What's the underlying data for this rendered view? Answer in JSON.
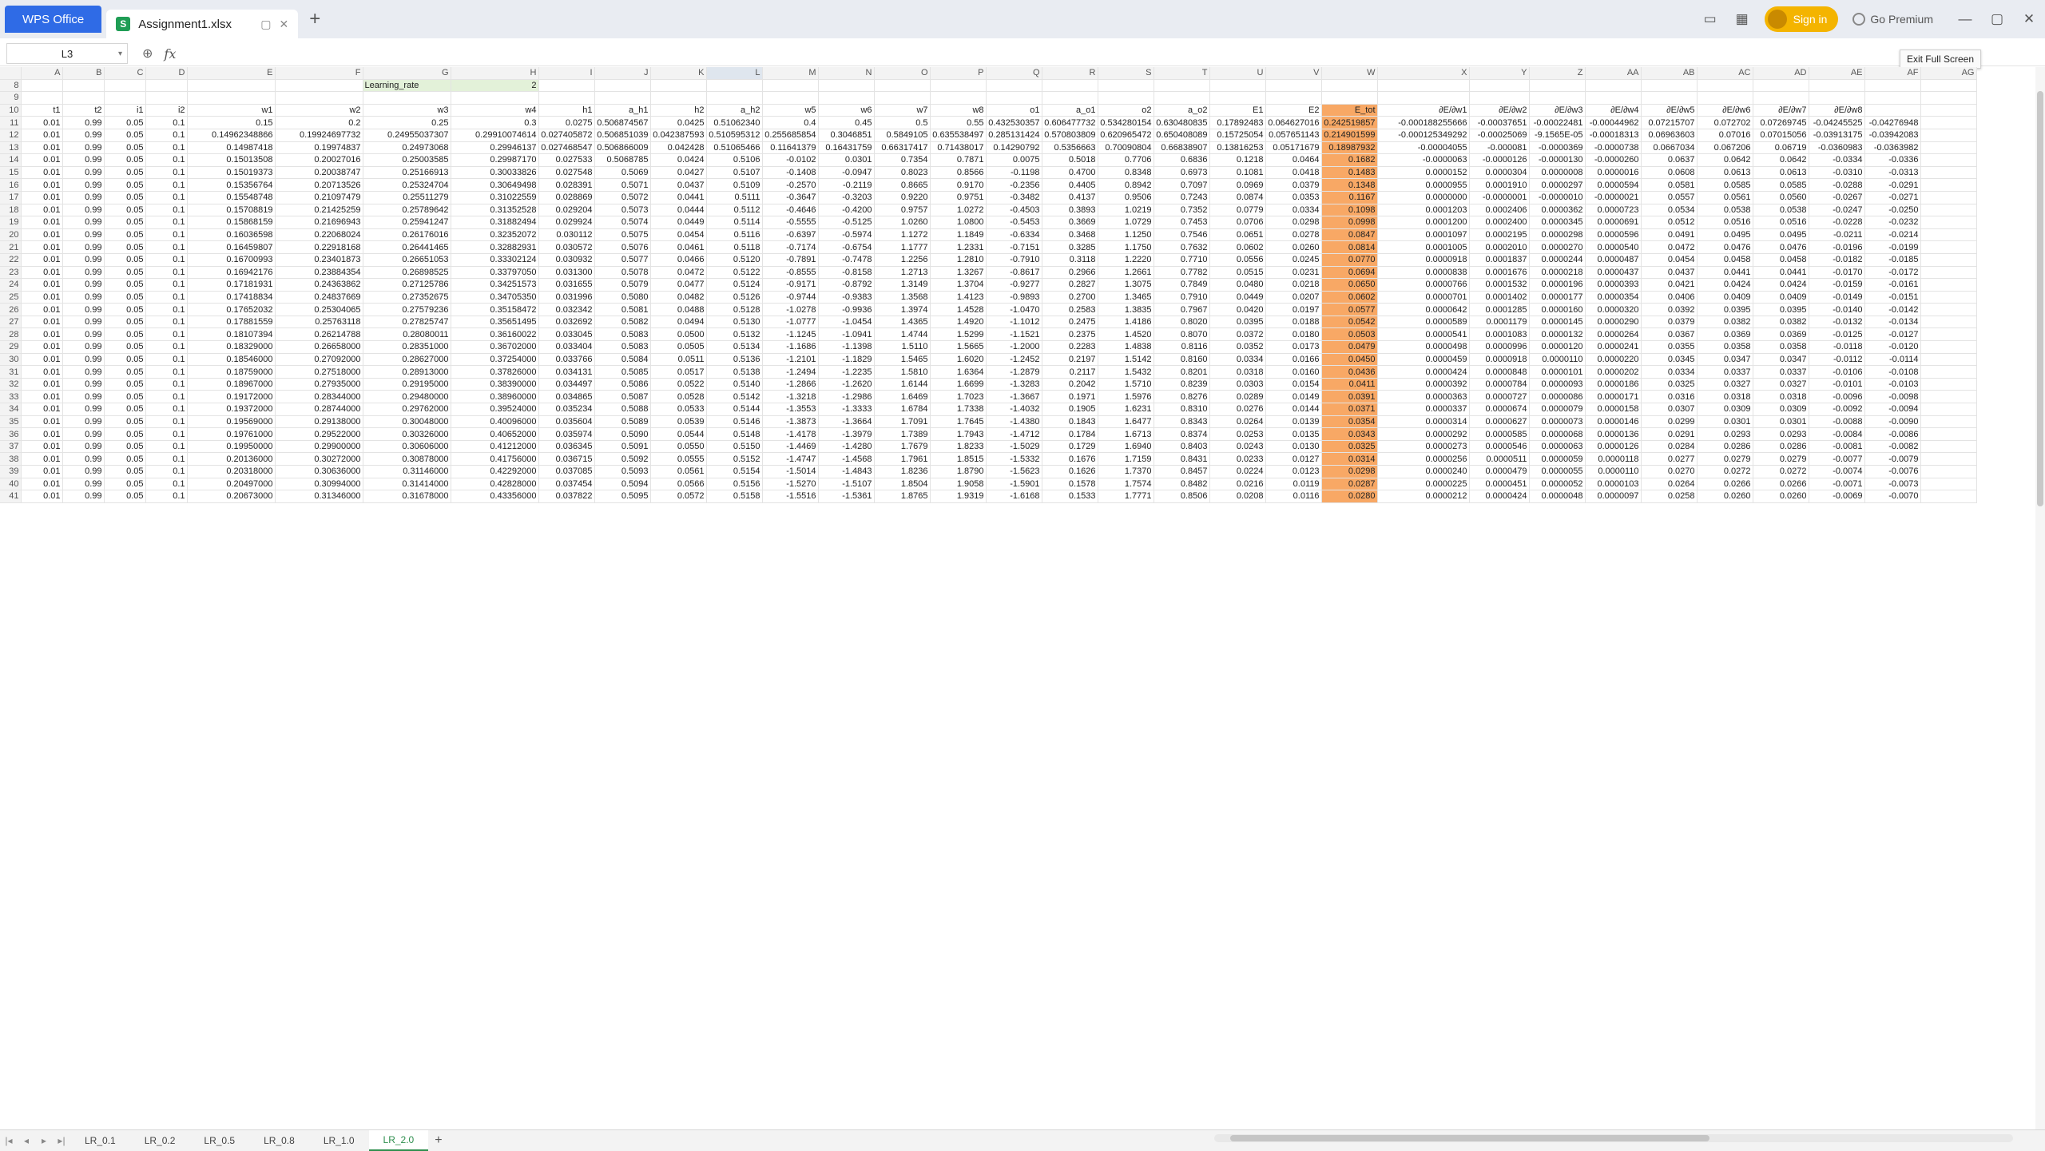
{
  "titlebar": {
    "app_tab": "WPS Office",
    "doc_tab": "Assignment1.xlsx",
    "sign_in": "Sign in",
    "premium": "Go Premium"
  },
  "formula_bar": {
    "cell_ref": "L3",
    "fx": "fx",
    "tooltip": "Exit Full Screen"
  },
  "columns": [
    "A",
    "B",
    "C",
    "D",
    "E",
    "F",
    "G",
    "H",
    "I",
    "J",
    "K",
    "L",
    "M",
    "N",
    "O",
    "P",
    "Q",
    "R",
    "S",
    "T",
    "U",
    "V",
    "W",
    "X",
    "Y",
    "Z",
    "AA",
    "AB",
    "AC",
    "AD",
    "AE",
    "AF",
    "AG"
  ],
  "learning_rate": {
    "label": "Learning_rate",
    "value": "2"
  },
  "headers": [
    "t1",
    "t2",
    "i1",
    "i2",
    "w1",
    "w2",
    "w3",
    "w4",
    "h1",
    "a_h1",
    "h2",
    "a_h2",
    "w5",
    "w6",
    "w7",
    "w8",
    "o1",
    "a_o1",
    "o2",
    "a_o2",
    "E1",
    "E2",
    "E_tot",
    "∂E/∂w1",
    "∂E/∂w2",
    "∂E/∂w3",
    "∂E/∂w4",
    "∂E/∂w5",
    "∂E/∂w6",
    "∂E/∂w7",
    "∂E/∂w8"
  ],
  "rows": [
    [
      "0.01",
      "0.99",
      "0.05",
      "0.1",
      "0.15",
      "0.2",
      "0.25",
      "0.3",
      "0.0275",
      "0.506874567",
      "0.0425",
      "0.51062340",
      "0.4",
      "0.45",
      "0.5",
      "0.55",
      "0.432530357",
      "0.606477732",
      "0.534280154",
      "0.630480835",
      "0.17892483",
      "0.064627016",
      "0.242519857",
      "-0.000188255666",
      "-0.00037651",
      "-0.00022481",
      "-0.00044962",
      "0.07215707",
      "0.072702",
      "0.07269745",
      "-0.04245525",
      "-0.04276948"
    ],
    [
      "0.01",
      "0.99",
      "0.05",
      "0.1",
      "0.14962348866",
      "0.19924697732",
      "0.24955037307",
      "0.29910074614",
      "0.027405872",
      "0.506851039",
      "0.042387593",
      "0.510595312",
      "0.255685854",
      "0.3046851",
      "0.5849105",
      "0.635538497",
      "0.285131424",
      "0.570803809",
      "0.620965472",
      "0.650408089",
      "0.15725054",
      "0.057651143",
      "0.214901599",
      "-0.000125349292",
      "-0.00025069",
      "-9.1565E-05",
      "-0.00018313",
      "0.06963603",
      "0.07016",
      "0.07015056",
      "-0.03913175",
      "-0.03942083"
    ],
    [
      "0.01",
      "0.99",
      "0.05",
      "0.1",
      "0.14987418",
      "0.19974837",
      "0.24973068",
      "0.29946137",
      "0.027468547",
      "0.506866009",
      "0.042428",
      "0.51065466",
      "0.11641379",
      "0.16431759",
      "0.66317417",
      "0.71438017",
      "0.14290792",
      "0.5356663",
      "0.70090804",
      "0.66838907",
      "0.13816253",
      "0.05171679",
      "0.18987932",
      "-0.00004055",
      "-0.000081",
      "-0.0000369",
      "-0.0000738",
      "0.0667034",
      "0.067206",
      "0.06719",
      "-0.0360983",
      "-0.0363982"
    ],
    [
      "0.01",
      "0.99",
      "0.05",
      "0.1",
      "0.15013508",
      "0.20027016",
      "0.25003585",
      "0.29987170",
      "0.027533",
      "0.5068785",
      "0.0424",
      "0.5106",
      "-0.0102",
      "0.0301",
      "0.7354",
      "0.7871",
      "0.0075",
      "0.5018",
      "0.7706",
      "0.6836",
      "0.1218",
      "0.0464",
      "0.1682",
      "-0.0000063",
      "-0.0000126",
      "-0.0000130",
      "-0.0000260",
      "0.0637",
      "0.0642",
      "0.0642",
      "-0.0334",
      "-0.0336"
    ],
    [
      "0.01",
      "0.99",
      "0.05",
      "0.1",
      "0.15019373",
      "0.20038747",
      "0.25166913",
      "0.30033826",
      "0.027548",
      "0.5069",
      "0.0427",
      "0.5107",
      "-0.1408",
      "-0.0947",
      "0.8023",
      "0.8566",
      "-0.1198",
      "0.4700",
      "0.8348",
      "0.6973",
      "0.1081",
      "0.0418",
      "0.1483",
      "0.0000152",
      "0.0000304",
      "0.0000008",
      "0.0000016",
      "0.0608",
      "0.0613",
      "0.0613",
      "-0.0310",
      "-0.0313"
    ],
    [
      "0.01",
      "0.99",
      "0.05",
      "0.1",
      "0.15356764",
      "0.20713526",
      "0.25324704",
      "0.30649498",
      "0.028391",
      "0.5071",
      "0.0437",
      "0.5109",
      "-0.2570",
      "-0.2119",
      "0.8665",
      "0.9170",
      "-0.2356",
      "0.4405",
      "0.8942",
      "0.7097",
      "0.0969",
      "0.0379",
      "0.1348",
      "0.0000955",
      "0.0001910",
      "0.0000297",
      "0.0000594",
      "0.0581",
      "0.0585",
      "0.0585",
      "-0.0288",
      "-0.0291"
    ],
    [
      "0.01",
      "0.99",
      "0.05",
      "0.1",
      "0.15548748",
      "0.21097479",
      "0.25511279",
      "0.31022559",
      "0.028869",
      "0.5072",
      "0.0441",
      "0.5111",
      "-0.3647",
      "-0.3203",
      "0.9220",
      "0.9751",
      "-0.3482",
      "0.4137",
      "0.9506",
      "0.7243",
      "0.0874",
      "0.0353",
      "0.1167",
      "0.0000000",
      "-0.0000001",
      "-0.0000010",
      "-0.0000021",
      "0.0557",
      "0.0561",
      "0.0560",
      "-0.0267",
      "-0.0271"
    ],
    [
      "0.01",
      "0.99",
      "0.05",
      "0.1",
      "0.15708819",
      "0.21425259",
      "0.25789642",
      "0.31352528",
      "0.029204",
      "0.5073",
      "0.0444",
      "0.5112",
      "-0.4646",
      "-0.4200",
      "0.9757",
      "1.0272",
      "-0.4503",
      "0.3893",
      "1.0219",
      "0.7352",
      "0.0779",
      "0.0334",
      "0.1098",
      "0.0001203",
      "0.0002406",
      "0.0000362",
      "0.0000723",
      "0.0534",
      "0.0538",
      "0.0538",
      "-0.0247",
      "-0.0250"
    ],
    [
      "0.01",
      "0.99",
      "0.05",
      "0.1",
      "0.15868159",
      "0.21696943",
      "0.25941247",
      "0.31882494",
      "0.029924",
      "0.5074",
      "0.0449",
      "0.5114",
      "-0.5555",
      "-0.5125",
      "1.0260",
      "1.0800",
      "-0.5453",
      "0.3669",
      "1.0729",
      "0.7453",
      "0.0706",
      "0.0298",
      "0.0998",
      "0.0001200",
      "0.0002400",
      "0.0000345",
      "0.0000691",
      "0.0512",
      "0.0516",
      "0.0516",
      "-0.0228",
      "-0.0232"
    ],
    [
      "0.01",
      "0.99",
      "0.05",
      "0.1",
      "0.16036598",
      "0.22068024",
      "0.26176016",
      "0.32352072",
      "0.030112",
      "0.5075",
      "0.0454",
      "0.5116",
      "-0.6397",
      "-0.5974",
      "1.1272",
      "1.1849",
      "-0.6334",
      "0.3468",
      "1.1250",
      "0.7546",
      "0.0651",
      "0.0278",
      "0.0847",
      "0.0001097",
      "0.0002195",
      "0.0000298",
      "0.0000596",
      "0.0491",
      "0.0495",
      "0.0495",
      "-0.0211",
      "-0.0214"
    ],
    [
      "0.01",
      "0.99",
      "0.05",
      "0.1",
      "0.16459807",
      "0.22918168",
      "0.26441465",
      "0.32882931",
      "0.030572",
      "0.5076",
      "0.0461",
      "0.5118",
      "-0.7174",
      "-0.6754",
      "1.1777",
      "1.2331",
      "-0.7151",
      "0.3285",
      "1.1750",
      "0.7632",
      "0.0602",
      "0.0260",
      "0.0814",
      "0.0001005",
      "0.0002010",
      "0.0000270",
      "0.0000540",
      "0.0472",
      "0.0476",
      "0.0476",
      "-0.0196",
      "-0.0199"
    ],
    [
      "0.01",
      "0.99",
      "0.05",
      "0.1",
      "0.16700993",
      "0.23401873",
      "0.26651053",
      "0.33302124",
      "0.030932",
      "0.5077",
      "0.0466",
      "0.5120",
      "-0.7891",
      "-0.7478",
      "1.2256",
      "1.2810",
      "-0.7910",
      "0.3118",
      "1.2220",
      "0.7710",
      "0.0556",
      "0.0245",
      "0.0770",
      "0.0000918",
      "0.0001837",
      "0.0000244",
      "0.0000487",
      "0.0454",
      "0.0458",
      "0.0458",
      "-0.0182",
      "-0.0185"
    ],
    [
      "0.01",
      "0.99",
      "0.05",
      "0.1",
      "0.16942176",
      "0.23884354",
      "0.26898525",
      "0.33797050",
      "0.031300",
      "0.5078",
      "0.0472",
      "0.5122",
      "-0.8555",
      "-0.8158",
      "1.2713",
      "1.3267",
      "-0.8617",
      "0.2966",
      "1.2661",
      "0.7782",
      "0.0515",
      "0.0231",
      "0.0694",
      "0.0000838",
      "0.0001676",
      "0.0000218",
      "0.0000437",
      "0.0437",
      "0.0441",
      "0.0441",
      "-0.0170",
      "-0.0172"
    ],
    [
      "0.01",
      "0.99",
      "0.05",
      "0.1",
      "0.17181931",
      "0.24363862",
      "0.27125786",
      "0.34251573",
      "0.031655",
      "0.5079",
      "0.0477",
      "0.5124",
      "-0.9171",
      "-0.8792",
      "1.3149",
      "1.3704",
      "-0.9277",
      "0.2827",
      "1.3075",
      "0.7849",
      "0.0480",
      "0.0218",
      "0.0650",
      "0.0000766",
      "0.0001532",
      "0.0000196",
      "0.0000393",
      "0.0421",
      "0.0424",
      "0.0424",
      "-0.0159",
      "-0.0161"
    ],
    [
      "0.01",
      "0.99",
      "0.05",
      "0.1",
      "0.17418834",
      "0.24837669",
      "0.27352675",
      "0.34705350",
      "0.031996",
      "0.5080",
      "0.0482",
      "0.5126",
      "-0.9744",
      "-0.9383",
      "1.3568",
      "1.4123",
      "-0.9893",
      "0.2700",
      "1.3465",
      "0.7910",
      "0.0449",
      "0.0207",
      "0.0602",
      "0.0000701",
      "0.0001402",
      "0.0000177",
      "0.0000354",
      "0.0406",
      "0.0409",
      "0.0409",
      "-0.0149",
      "-0.0151"
    ],
    [
      "0.01",
      "0.99",
      "0.05",
      "0.1",
      "0.17652032",
      "0.25304065",
      "0.27579236",
      "0.35158472",
      "0.032342",
      "0.5081",
      "0.0488",
      "0.5128",
      "-1.0278",
      "-0.9936",
      "1.3974",
      "1.4528",
      "-1.0470",
      "0.2583",
      "1.3835",
      "0.7967",
      "0.0420",
      "0.0197",
      "0.0577",
      "0.0000642",
      "0.0001285",
      "0.0000160",
      "0.0000320",
      "0.0392",
      "0.0395",
      "0.0395",
      "-0.0140",
      "-0.0142"
    ],
    [
      "0.01",
      "0.99",
      "0.05",
      "0.1",
      "0.17881559",
      "0.25763118",
      "0.27825747",
      "0.35651495",
      "0.032692",
      "0.5082",
      "0.0494",
      "0.5130",
      "-1.0777",
      "-1.0454",
      "1.4365",
      "1.4920",
      "-1.1012",
      "0.2475",
      "1.4186",
      "0.8020",
      "0.0395",
      "0.0188",
      "0.0542",
      "0.0000589",
      "0.0001179",
      "0.0000145",
      "0.0000290",
      "0.0379",
      "0.0382",
      "0.0382",
      "-0.0132",
      "-0.0134"
    ],
    [
      "0.01",
      "0.99",
      "0.05",
      "0.1",
      "0.18107394",
      "0.26214788",
      "0.28080011",
      "0.36160022",
      "0.033045",
      "0.5083",
      "0.0500",
      "0.5132",
      "-1.1245",
      "-1.0941",
      "1.4744",
      "1.5299",
      "-1.1521",
      "0.2375",
      "1.4520",
      "0.8070",
      "0.0372",
      "0.0180",
      "0.0503",
      "0.0000541",
      "0.0001083",
      "0.0000132",
      "0.0000264",
      "0.0367",
      "0.0369",
      "0.0369",
      "-0.0125",
      "-0.0127"
    ],
    [
      "0.01",
      "0.99",
      "0.05",
      "0.1",
      "0.18329000",
      "0.26658000",
      "0.28351000",
      "0.36702000",
      "0.033404",
      "0.5083",
      "0.0505",
      "0.5134",
      "-1.1686",
      "-1.1398",
      "1.5110",
      "1.5665",
      "-1.2000",
      "0.2283",
      "1.4838",
      "0.8116",
      "0.0352",
      "0.0173",
      "0.0479",
      "0.0000498",
      "0.0000996",
      "0.0000120",
      "0.0000241",
      "0.0355",
      "0.0358",
      "0.0358",
      "-0.0118",
      "-0.0120"
    ],
    [
      "0.01",
      "0.99",
      "0.05",
      "0.1",
      "0.18546000",
      "0.27092000",
      "0.28627000",
      "0.37254000",
      "0.033766",
      "0.5084",
      "0.0511",
      "0.5136",
      "-1.2101",
      "-1.1829",
      "1.5465",
      "1.6020",
      "-1.2452",
      "0.2197",
      "1.5142",
      "0.8160",
      "0.0334",
      "0.0166",
      "0.0450",
      "0.0000459",
      "0.0000918",
      "0.0000110",
      "0.0000220",
      "0.0345",
      "0.0347",
      "0.0347",
      "-0.0112",
      "-0.0114"
    ],
    [
      "0.01",
      "0.99",
      "0.05",
      "0.1",
      "0.18759000",
      "0.27518000",
      "0.28913000",
      "0.37826000",
      "0.034131",
      "0.5085",
      "0.0517",
      "0.5138",
      "-1.2494",
      "-1.2235",
      "1.5810",
      "1.6364",
      "-1.2879",
      "0.2117",
      "1.5432",
      "0.8201",
      "0.0318",
      "0.0160",
      "0.0436",
      "0.0000424",
      "0.0000848",
      "0.0000101",
      "0.0000202",
      "0.0334",
      "0.0337",
      "0.0337",
      "-0.0106",
      "-0.0108"
    ],
    [
      "0.01",
      "0.99",
      "0.05",
      "0.1",
      "0.18967000",
      "0.27935000",
      "0.29195000",
      "0.38390000",
      "0.034497",
      "0.5086",
      "0.0522",
      "0.5140",
      "-1.2866",
      "-1.2620",
      "1.6144",
      "1.6699",
      "-1.3283",
      "0.2042",
      "1.5710",
      "0.8239",
      "0.0303",
      "0.0154",
      "0.0411",
      "0.0000392",
      "0.0000784",
      "0.0000093",
      "0.0000186",
      "0.0325",
      "0.0327",
      "0.0327",
      "-0.0101",
      "-0.0103"
    ],
    [
      "0.01",
      "0.99",
      "0.05",
      "0.1",
      "0.19172000",
      "0.28344000",
      "0.29480000",
      "0.38960000",
      "0.034865",
      "0.5087",
      "0.0528",
      "0.5142",
      "-1.3218",
      "-1.2986",
      "1.6469",
      "1.7023",
      "-1.3667",
      "0.1971",
      "1.5976",
      "0.8276",
      "0.0289",
      "0.0149",
      "0.0391",
      "0.0000363",
      "0.0000727",
      "0.0000086",
      "0.0000171",
      "0.0316",
      "0.0318",
      "0.0318",
      "-0.0096",
      "-0.0098"
    ],
    [
      "0.01",
      "0.99",
      "0.05",
      "0.1",
      "0.19372000",
      "0.28744000",
      "0.29762000",
      "0.39524000",
      "0.035234",
      "0.5088",
      "0.0533",
      "0.5144",
      "-1.3553",
      "-1.3333",
      "1.6784",
      "1.7338",
      "-1.4032",
      "0.1905",
      "1.6231",
      "0.8310",
      "0.0276",
      "0.0144",
      "0.0371",
      "0.0000337",
      "0.0000674",
      "0.0000079",
      "0.0000158",
      "0.0307",
      "0.0309",
      "0.0309",
      "-0.0092",
      "-0.0094"
    ],
    [
      "0.01",
      "0.99",
      "0.05",
      "0.1",
      "0.19569000",
      "0.29138000",
      "0.30048000",
      "0.40096000",
      "0.035604",
      "0.5089",
      "0.0539",
      "0.5146",
      "-1.3873",
      "-1.3664",
      "1.7091",
      "1.7645",
      "-1.4380",
      "0.1843",
      "1.6477",
      "0.8343",
      "0.0264",
      "0.0139",
      "0.0354",
      "0.0000314",
      "0.0000627",
      "0.0000073",
      "0.0000146",
      "0.0299",
      "0.0301",
      "0.0301",
      "-0.0088",
      "-0.0090"
    ],
    [
      "0.01",
      "0.99",
      "0.05",
      "0.1",
      "0.19761000",
      "0.29522000",
      "0.30326000",
      "0.40652000",
      "0.035974",
      "0.5090",
      "0.0544",
      "0.5148",
      "-1.4178",
      "-1.3979",
      "1.7389",
      "1.7943",
      "-1.4712",
      "0.1784",
      "1.6713",
      "0.8374",
      "0.0253",
      "0.0135",
      "0.0343",
      "0.0000292",
      "0.0000585",
      "0.0000068",
      "0.0000136",
      "0.0291",
      "0.0293",
      "0.0293",
      "-0.0084",
      "-0.0086"
    ],
    [
      "0.01",
      "0.99",
      "0.05",
      "0.1",
      "0.19950000",
      "0.29900000",
      "0.30606000",
      "0.41212000",
      "0.036345",
      "0.5091",
      "0.0550",
      "0.5150",
      "-1.4469",
      "-1.4280",
      "1.7679",
      "1.8233",
      "-1.5029",
      "0.1729",
      "1.6940",
      "0.8403",
      "0.0243",
      "0.0130",
      "0.0325",
      "0.0000273",
      "0.0000546",
      "0.0000063",
      "0.0000126",
      "0.0284",
      "0.0286",
      "0.0286",
      "-0.0081",
      "-0.0082"
    ],
    [
      "0.01",
      "0.99",
      "0.05",
      "0.1",
      "0.20136000",
      "0.30272000",
      "0.30878000",
      "0.41756000",
      "0.036715",
      "0.5092",
      "0.0555",
      "0.5152",
      "-1.4747",
      "-1.4568",
      "1.7961",
      "1.8515",
      "-1.5332",
      "0.1676",
      "1.7159",
      "0.8431",
      "0.0233",
      "0.0127",
      "0.0314",
      "0.0000256",
      "0.0000511",
      "0.0000059",
      "0.0000118",
      "0.0277",
      "0.0279",
      "0.0279",
      "-0.0077",
      "-0.0079"
    ],
    [
      "0.01",
      "0.99",
      "0.05",
      "0.1",
      "0.20318000",
      "0.30636000",
      "0.31146000",
      "0.42292000",
      "0.037085",
      "0.5093",
      "0.0561",
      "0.5154",
      "-1.5014",
      "-1.4843",
      "1.8236",
      "1.8790",
      "-1.5623",
      "0.1626",
      "1.7370",
      "0.8457",
      "0.0224",
      "0.0123",
      "0.0298",
      "0.0000240",
      "0.0000479",
      "0.0000055",
      "0.0000110",
      "0.0270",
      "0.0272",
      "0.0272",
      "-0.0074",
      "-0.0076"
    ],
    [
      "0.01",
      "0.99",
      "0.05",
      "0.1",
      "0.20497000",
      "0.30994000",
      "0.31414000",
      "0.42828000",
      "0.037454",
      "0.5094",
      "0.0566",
      "0.5156",
      "-1.5270",
      "-1.5107",
      "1.8504",
      "1.9058",
      "-1.5901",
      "0.1578",
      "1.7574",
      "0.8482",
      "0.0216",
      "0.0119",
      "0.0287",
      "0.0000225",
      "0.0000451",
      "0.0000052",
      "0.0000103",
      "0.0264",
      "0.0266",
      "0.0266",
      "-0.0071",
      "-0.0073"
    ],
    [
      "0.01",
      "0.99",
      "0.05",
      "0.1",
      "0.20673000",
      "0.31346000",
      "0.31678000",
      "0.43356000",
      "0.037822",
      "0.5095",
      "0.0572",
      "0.5158",
      "-1.5516",
      "-1.5361",
      "1.8765",
      "1.9319",
      "-1.6168",
      "0.1533",
      "1.7771",
      "0.8506",
      "0.0208",
      "0.0116",
      "0.0280",
      "0.0000212",
      "0.0000424",
      "0.0000048",
      "0.0000097",
      "0.0258",
      "0.0260",
      "0.0260",
      "-0.0069",
      "-0.0070"
    ]
  ]
}
